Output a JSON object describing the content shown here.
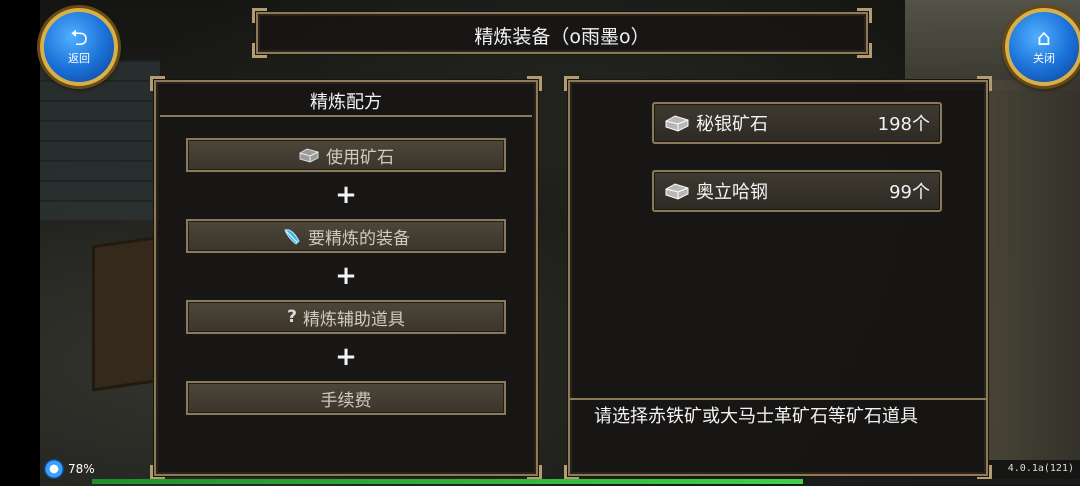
{
  "window": {
    "title": "精炼装备（o雨墨o）"
  },
  "nav": {
    "back_label": "返回",
    "close_label": "关闭"
  },
  "recipe": {
    "heading": "精炼配方",
    "slots": [
      {
        "label": "使用矿石",
        "icon": "ore-icon"
      },
      {
        "label": "要精炼的装备",
        "icon": "feather-icon"
      },
      {
        "label": "精炼辅助道具",
        "icon": "question-icon"
      },
      {
        "label": "手续费",
        "icon": ""
      }
    ],
    "plus_symbol": "+"
  },
  "materials": [
    {
      "name": "秘银矿石",
      "qty": "198个",
      "icon": "ore-icon"
    },
    {
      "name": "奥立哈钢",
      "qty": "99个",
      "icon": "ore-icon"
    }
  ],
  "hint": "请选择赤铁矿或大马士革矿石等矿石道具",
  "status": {
    "battery_percent": "78%",
    "version": "4.0.1a(121)",
    "exp_fraction": 0.72
  },
  "colors": {
    "panel_border": "#8d7a5a",
    "button_blue": "#1a6fd6",
    "button_gold": "#d8b04a",
    "exp_green": "#3fd14a"
  }
}
